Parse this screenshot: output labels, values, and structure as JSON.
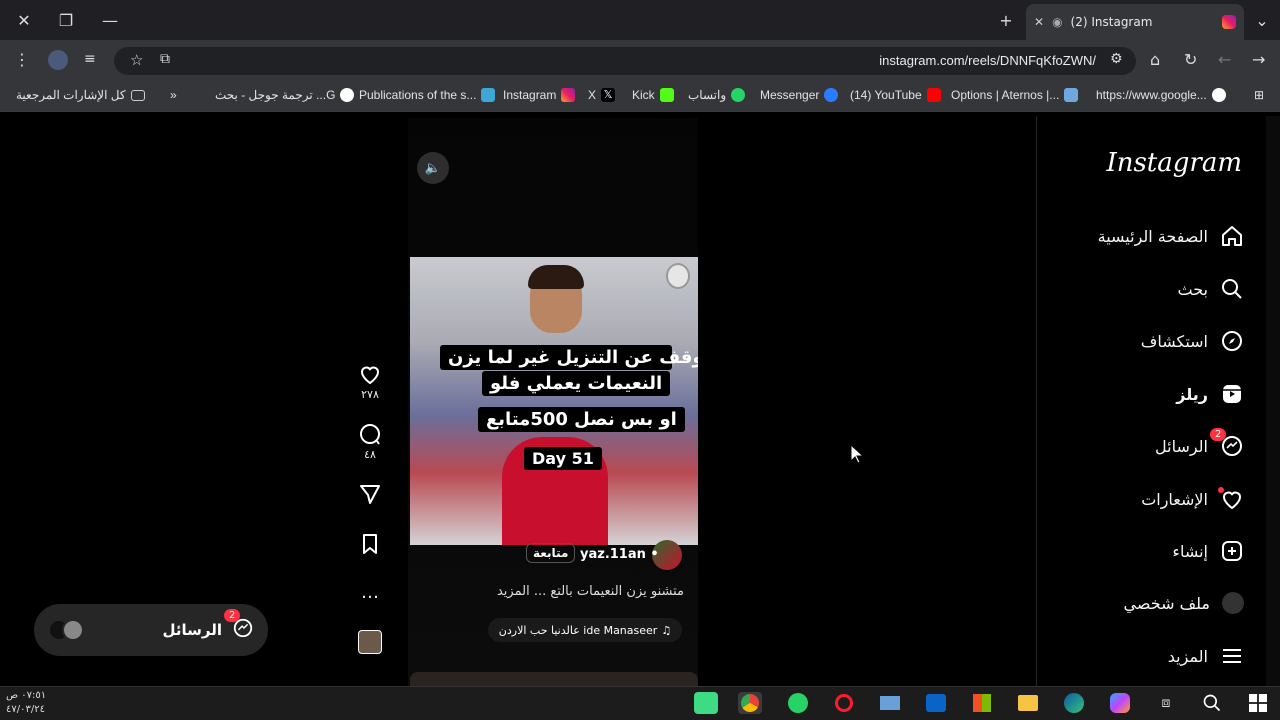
{
  "browser": {
    "tab_title": "(2) Instagram",
    "url": "instagram.com/reels/DNNFqKfoZWN/"
  },
  "bookmarks": [
    {
      "label": "كل الإشارات المرجعية",
      "icon": "folder-icon"
    },
    {
      "label": "ترجمة جوجل - بحث ...G",
      "icon": "google-icon"
    },
    {
      "label": "Publications of the s...",
      "icon": "tl-icon"
    },
    {
      "label": "Instagram",
      "icon": "instagram-icon"
    },
    {
      "label": "X",
      "icon": "x-icon"
    },
    {
      "label": "Kick",
      "icon": "kick-icon"
    },
    {
      "label": "واتساب",
      "icon": "whatsapp-icon"
    },
    {
      "label": "Messenger",
      "icon": "messenger-icon"
    },
    {
      "label": "(14) YouTube",
      "icon": "youtube-icon"
    },
    {
      "label": "Options | Aternos |...",
      "icon": "aternos-icon"
    },
    {
      "label": "https://www.google...",
      "icon": "google-icon"
    }
  ],
  "sidebar": {
    "logo": "Instagram",
    "items": [
      {
        "label": "الصفحة الرئيسية",
        "icon": "home-icon"
      },
      {
        "label": "بحث",
        "icon": "search-icon"
      },
      {
        "label": "استكشاف",
        "icon": "compass-icon"
      },
      {
        "label": "ريلز",
        "icon": "reels-icon"
      },
      {
        "label": "الرسائل",
        "icon": "messenger-icon",
        "badge": "2"
      },
      {
        "label": "الإشعارات",
        "icon": "heart-icon"
      },
      {
        "label": "إنشاء",
        "icon": "create-icon"
      },
      {
        "label": "ملف شخصي",
        "icon": "avatar-icon"
      },
      {
        "label": "المزيد",
        "icon": "menu-icon"
      }
    ]
  },
  "reel": {
    "caption_lines": [
      "ما رح اتوقف عن التنزيل غير لما يزن",
      "النعيمات يعملي فلو",
      "او بس نصل 500متابع",
      "Day 51"
    ],
    "likes": "٢٧٨",
    "comments": "٤٨",
    "username": "yaz.11an",
    "follow_label": "متابعة",
    "description": "متشنو يزن النعيمات بالتع ... المزيد",
    "audio": "عالدنيا حب الاردن ide Manaseer"
  },
  "messages_pill": {
    "label": "الرسائل",
    "badge": "2"
  },
  "taskbar": {
    "time": "٠٧:٥١ ص",
    "date": "٤٧/٠٣/٢٤"
  }
}
